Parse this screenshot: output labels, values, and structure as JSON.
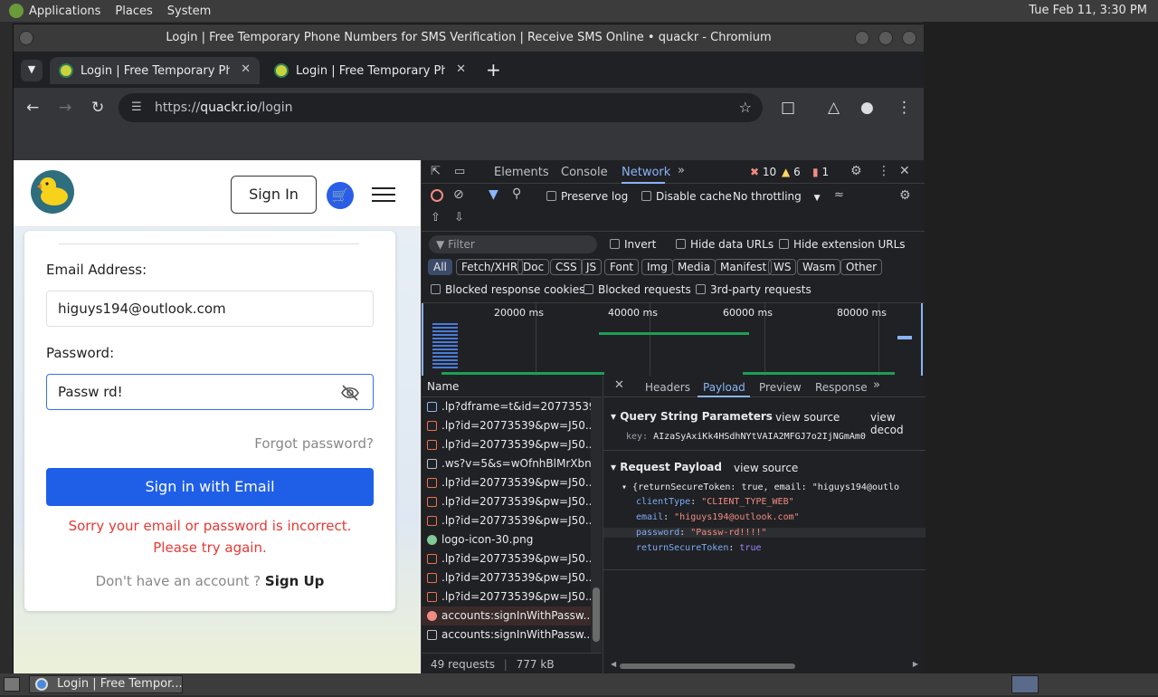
{
  "system_panel": {
    "menus": [
      "Applications",
      "Places",
      "System"
    ],
    "clock": "Tue Feb 11,  3:30 PM"
  },
  "window": {
    "title": "Login | Free Temporary Phone Numbers for SMS Verification | Receive SMS Online • quackr - Chromium"
  },
  "tabs": [
    {
      "title": "Login | Free Temporary Phone Numbers",
      "active": true
    },
    {
      "title": "Login | Free Temporary Phone Numbers",
      "active": false
    }
  ],
  "address_bar": {
    "scheme": "https://",
    "host": "quackr.io",
    "path": "/login"
  },
  "site": {
    "signin_label": "Sign In",
    "email_label": "Email Address:",
    "email_value": "higuys194@outlook.com",
    "password_label": "Password:",
    "password_value": "Passw rd!",
    "forgot_label": "Forgot password?",
    "email_signin_label": "Sign in with Email",
    "error": "Sorry your email or password is incorrect. Please try again.",
    "no_account": "Don't have an account ?",
    "signup_label": "Sign Up"
  },
  "devtools": {
    "tabs": [
      "Elements",
      "Console",
      "Network"
    ],
    "active_tab": "Network",
    "counts": {
      "errors": "10",
      "warnings": "6",
      "info": "1"
    },
    "preserve_log": "Preserve log",
    "disable_cache": "Disable cache",
    "throttling": "No throttling",
    "filter_placeholder": "Filter",
    "invert": "Invert",
    "hide_data_urls": "Hide data URLs",
    "hide_ext_urls": "Hide extension URLs",
    "type_filters": [
      "All",
      "Fetch/XHR",
      "Doc",
      "CSS",
      "JS",
      "Font",
      "Img",
      "Media",
      "Manifest",
      "WS",
      "Wasm",
      "Other"
    ],
    "blocked_cookies": "Blocked response cookies",
    "blocked_requests": "Blocked requests",
    "third_party": "3rd-party requests",
    "timeline_ticks": [
      "20000 ms",
      "40000 ms",
      "60000 ms",
      "80000 ms"
    ],
    "name_header": "Name",
    "requests": [
      {
        "name": ".lp?dframe=t&id=20773539&pw=J50...",
        "kind": "doc"
      },
      {
        "name": ".lp?id=20773539&pw=J50...",
        "kind": "xhr"
      },
      {
        "name": ".lp?id=20773539&pw=J50...",
        "kind": "xhr"
      },
      {
        "name": ".ws?v=5&s=wOfnhBlMrXbn...",
        "kind": "ws"
      },
      {
        "name": ".lp?id=20773539&pw=J50...",
        "kind": "xhr"
      },
      {
        "name": ".lp?id=20773539&pw=J50...",
        "kind": "xhr"
      },
      {
        "name": ".lp?id=20773539&pw=J50...",
        "kind": "xhr"
      },
      {
        "name": "logo-icon-30.png",
        "kind": "img"
      },
      {
        "name": ".lp?id=20773539&pw=J50...",
        "kind": "xhr"
      },
      {
        "name": ".lp?id=20773539&pw=J50...",
        "kind": "xhr"
      },
      {
        "name": ".lp?id=20773539&pw=J50...",
        "kind": "xhr"
      },
      {
        "name": "accounts:signInWithPassw...",
        "kind": "error"
      },
      {
        "name": "accounts:signInWithPassw...",
        "kind": "plain"
      }
    ],
    "footer_requests": "49 requests",
    "footer_transferred": "777 kB transferred",
    "detail_tabs": [
      "Headers",
      "Payload",
      "Preview",
      "Response"
    ],
    "detail_active": "Payload",
    "qs_title": "Query String Parameters",
    "view_source": "view source",
    "view_decoded": "view decod",
    "qs_key_label": "key:",
    "qs_key_value": "AIzaSyAxiKk4HSdhNYtVAIA2MFGJ7o2IjNGmAm0",
    "rp_title": "Request Payload",
    "rp_summary": "{returnSecureToken: true, email: \"higuys194@outlo",
    "rp_fields": [
      {
        "key": "clientType",
        "value": "\"CLIENT_TYPE_WEB\"",
        "type": "string"
      },
      {
        "key": "email",
        "value": "\"higuys194@outlook.com\"",
        "type": "string"
      },
      {
        "key": "password",
        "value": "\"Passw-rd!!!!\"",
        "type": "string"
      },
      {
        "key": "returnSecureToken",
        "value": "true",
        "type": "bool"
      }
    ]
  },
  "taskbar": {
    "item": "Login | Free Tempor..."
  }
}
